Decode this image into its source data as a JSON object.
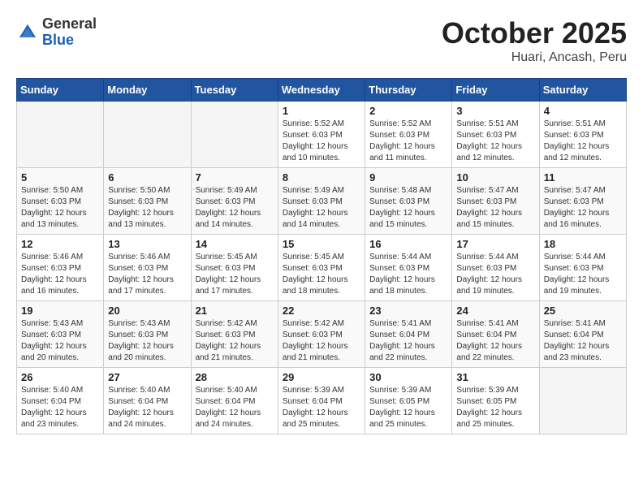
{
  "header": {
    "logo_general": "General",
    "logo_blue": "Blue",
    "month_title": "October 2025",
    "location": "Huari, Ancash, Peru"
  },
  "weekdays": [
    "Sunday",
    "Monday",
    "Tuesday",
    "Wednesday",
    "Thursday",
    "Friday",
    "Saturday"
  ],
  "weeks": [
    [
      {
        "day": "",
        "sunrise": "",
        "sunset": "",
        "daylight": ""
      },
      {
        "day": "",
        "sunrise": "",
        "sunset": "",
        "daylight": ""
      },
      {
        "day": "",
        "sunrise": "",
        "sunset": "",
        "daylight": ""
      },
      {
        "day": "1",
        "sunrise": "Sunrise: 5:52 AM",
        "sunset": "Sunset: 6:03 PM",
        "daylight": "Daylight: 12 hours and 10 minutes."
      },
      {
        "day": "2",
        "sunrise": "Sunrise: 5:52 AM",
        "sunset": "Sunset: 6:03 PM",
        "daylight": "Daylight: 12 hours and 11 minutes."
      },
      {
        "day": "3",
        "sunrise": "Sunrise: 5:51 AM",
        "sunset": "Sunset: 6:03 PM",
        "daylight": "Daylight: 12 hours and 12 minutes."
      },
      {
        "day": "4",
        "sunrise": "Sunrise: 5:51 AM",
        "sunset": "Sunset: 6:03 PM",
        "daylight": "Daylight: 12 hours and 12 minutes."
      }
    ],
    [
      {
        "day": "5",
        "sunrise": "Sunrise: 5:50 AM",
        "sunset": "Sunset: 6:03 PM",
        "daylight": "Daylight: 12 hours and 13 minutes."
      },
      {
        "day": "6",
        "sunrise": "Sunrise: 5:50 AM",
        "sunset": "Sunset: 6:03 PM",
        "daylight": "Daylight: 12 hours and 13 minutes."
      },
      {
        "day": "7",
        "sunrise": "Sunrise: 5:49 AM",
        "sunset": "Sunset: 6:03 PM",
        "daylight": "Daylight: 12 hours and 14 minutes."
      },
      {
        "day": "8",
        "sunrise": "Sunrise: 5:49 AM",
        "sunset": "Sunset: 6:03 PM",
        "daylight": "Daylight: 12 hours and 14 minutes."
      },
      {
        "day": "9",
        "sunrise": "Sunrise: 5:48 AM",
        "sunset": "Sunset: 6:03 PM",
        "daylight": "Daylight: 12 hours and 15 minutes."
      },
      {
        "day": "10",
        "sunrise": "Sunrise: 5:47 AM",
        "sunset": "Sunset: 6:03 PM",
        "daylight": "Daylight: 12 hours and 15 minutes."
      },
      {
        "day": "11",
        "sunrise": "Sunrise: 5:47 AM",
        "sunset": "Sunset: 6:03 PM",
        "daylight": "Daylight: 12 hours and 16 minutes."
      }
    ],
    [
      {
        "day": "12",
        "sunrise": "Sunrise: 5:46 AM",
        "sunset": "Sunset: 6:03 PM",
        "daylight": "Daylight: 12 hours and 16 minutes."
      },
      {
        "day": "13",
        "sunrise": "Sunrise: 5:46 AM",
        "sunset": "Sunset: 6:03 PM",
        "daylight": "Daylight: 12 hours and 17 minutes."
      },
      {
        "day": "14",
        "sunrise": "Sunrise: 5:45 AM",
        "sunset": "Sunset: 6:03 PM",
        "daylight": "Daylight: 12 hours and 17 minutes."
      },
      {
        "day": "15",
        "sunrise": "Sunrise: 5:45 AM",
        "sunset": "Sunset: 6:03 PM",
        "daylight": "Daylight: 12 hours and 18 minutes."
      },
      {
        "day": "16",
        "sunrise": "Sunrise: 5:44 AM",
        "sunset": "Sunset: 6:03 PM",
        "daylight": "Daylight: 12 hours and 18 minutes."
      },
      {
        "day": "17",
        "sunrise": "Sunrise: 5:44 AM",
        "sunset": "Sunset: 6:03 PM",
        "daylight": "Daylight: 12 hours and 19 minutes."
      },
      {
        "day": "18",
        "sunrise": "Sunrise: 5:44 AM",
        "sunset": "Sunset: 6:03 PM",
        "daylight": "Daylight: 12 hours and 19 minutes."
      }
    ],
    [
      {
        "day": "19",
        "sunrise": "Sunrise: 5:43 AM",
        "sunset": "Sunset: 6:03 PM",
        "daylight": "Daylight: 12 hours and 20 minutes."
      },
      {
        "day": "20",
        "sunrise": "Sunrise: 5:43 AM",
        "sunset": "Sunset: 6:03 PM",
        "daylight": "Daylight: 12 hours and 20 minutes."
      },
      {
        "day": "21",
        "sunrise": "Sunrise: 5:42 AM",
        "sunset": "Sunset: 6:03 PM",
        "daylight": "Daylight: 12 hours and 21 minutes."
      },
      {
        "day": "22",
        "sunrise": "Sunrise: 5:42 AM",
        "sunset": "Sunset: 6:03 PM",
        "daylight": "Daylight: 12 hours and 21 minutes."
      },
      {
        "day": "23",
        "sunrise": "Sunrise: 5:41 AM",
        "sunset": "Sunset: 6:04 PM",
        "daylight": "Daylight: 12 hours and 22 minutes."
      },
      {
        "day": "24",
        "sunrise": "Sunrise: 5:41 AM",
        "sunset": "Sunset: 6:04 PM",
        "daylight": "Daylight: 12 hours and 22 minutes."
      },
      {
        "day": "25",
        "sunrise": "Sunrise: 5:41 AM",
        "sunset": "Sunset: 6:04 PM",
        "daylight": "Daylight: 12 hours and 23 minutes."
      }
    ],
    [
      {
        "day": "26",
        "sunrise": "Sunrise: 5:40 AM",
        "sunset": "Sunset: 6:04 PM",
        "daylight": "Daylight: 12 hours and 23 minutes."
      },
      {
        "day": "27",
        "sunrise": "Sunrise: 5:40 AM",
        "sunset": "Sunset: 6:04 PM",
        "daylight": "Daylight: 12 hours and 24 minutes."
      },
      {
        "day": "28",
        "sunrise": "Sunrise: 5:40 AM",
        "sunset": "Sunset: 6:04 PM",
        "daylight": "Daylight: 12 hours and 24 minutes."
      },
      {
        "day": "29",
        "sunrise": "Sunrise: 5:39 AM",
        "sunset": "Sunset: 6:04 PM",
        "daylight": "Daylight: 12 hours and 25 minutes."
      },
      {
        "day": "30",
        "sunrise": "Sunrise: 5:39 AM",
        "sunset": "Sunset: 6:05 PM",
        "daylight": "Daylight: 12 hours and 25 minutes."
      },
      {
        "day": "31",
        "sunrise": "Sunrise: 5:39 AM",
        "sunset": "Sunset: 6:05 PM",
        "daylight": "Daylight: 12 hours and 25 minutes."
      },
      {
        "day": "",
        "sunrise": "",
        "sunset": "",
        "daylight": ""
      }
    ]
  ]
}
